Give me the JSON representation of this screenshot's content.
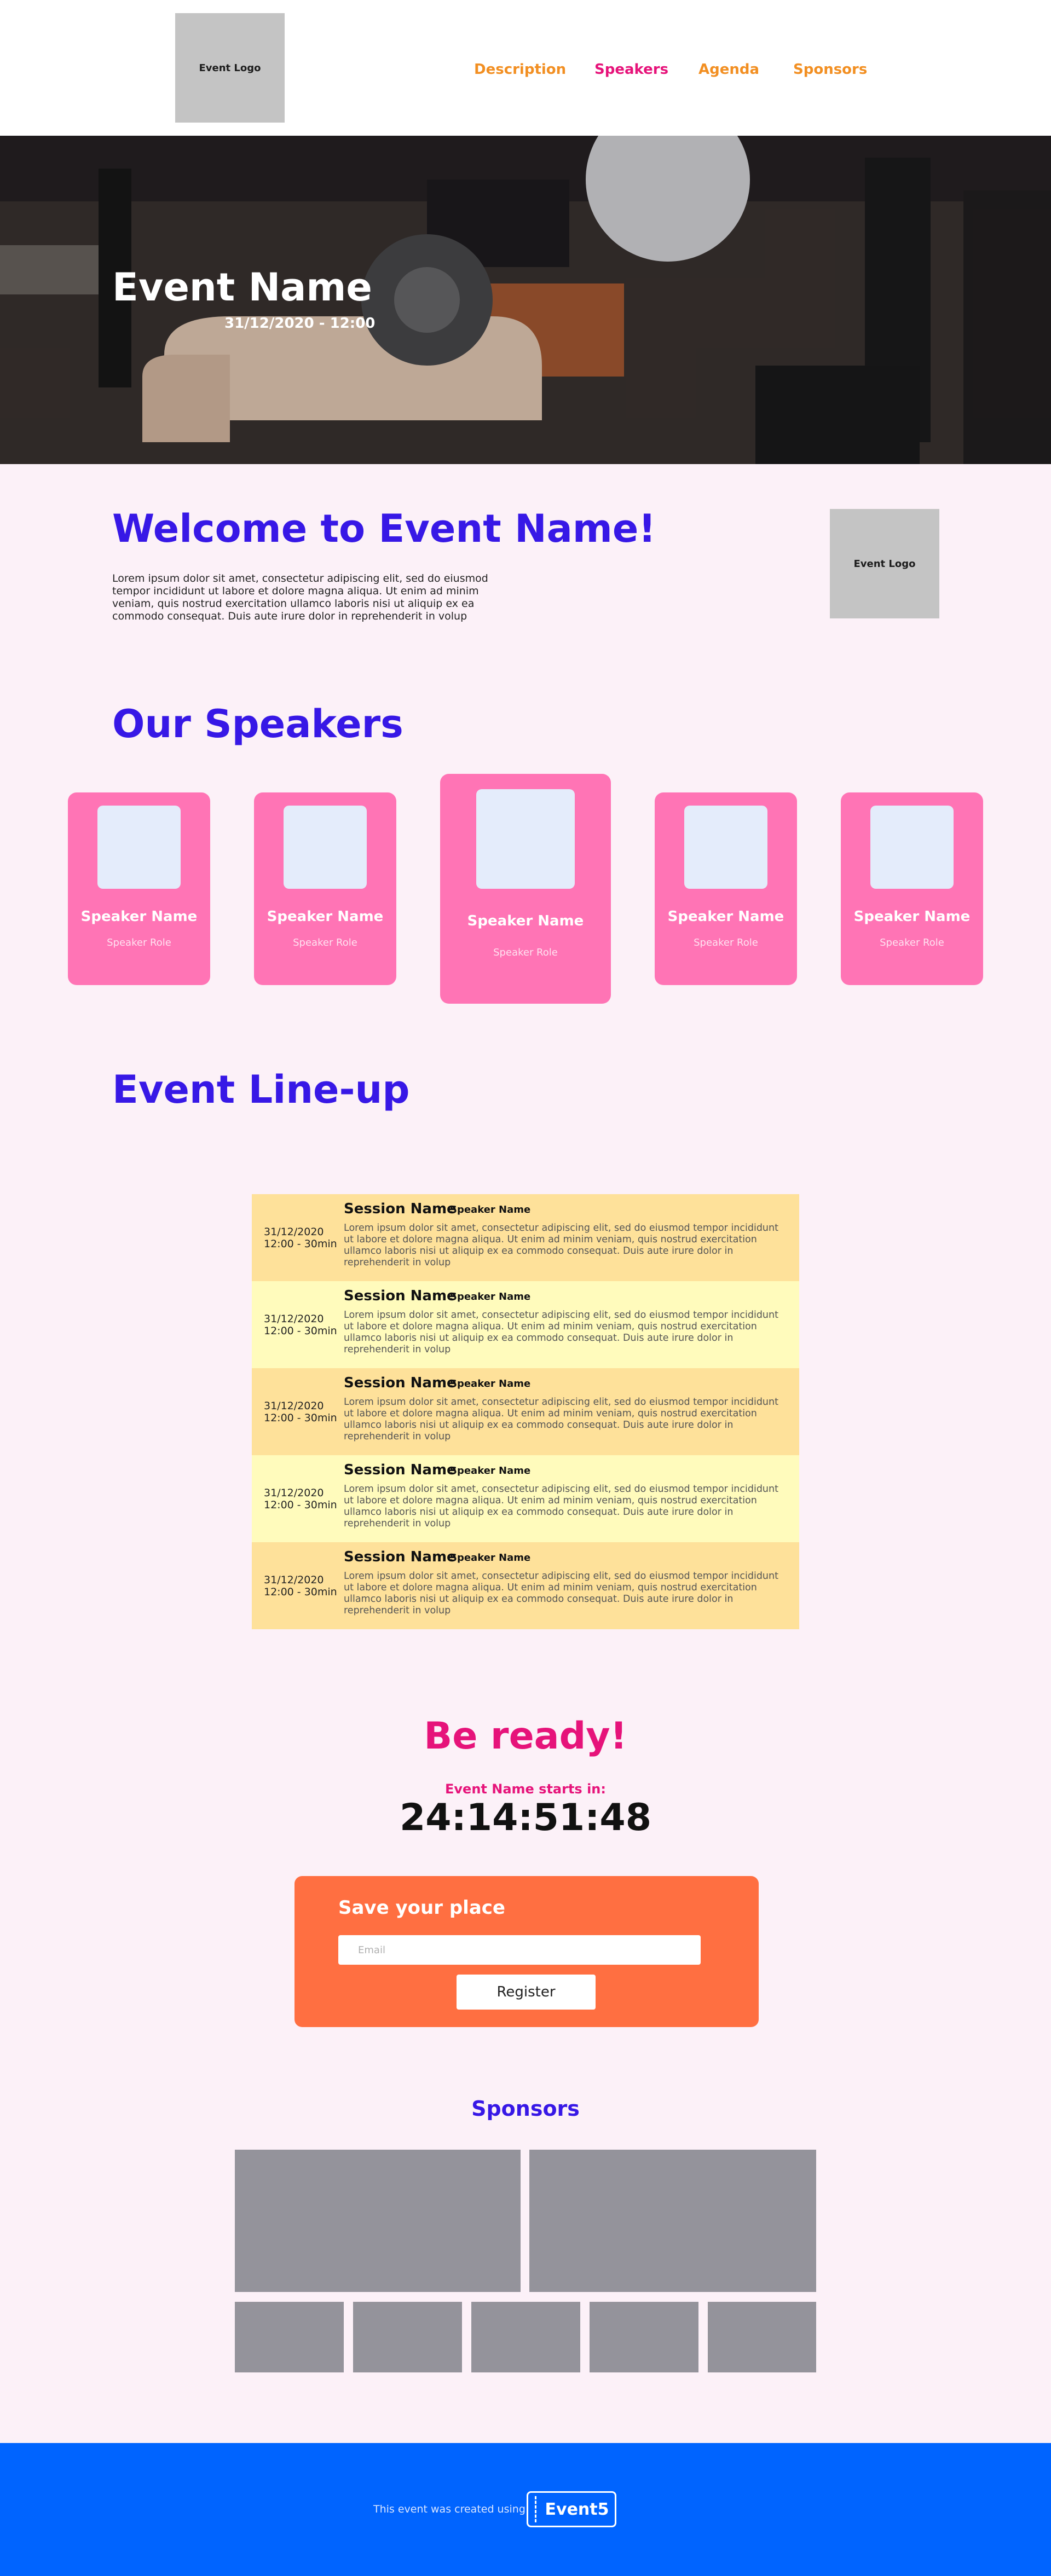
{
  "header": {
    "logo_label": "Event Logo",
    "nav": [
      {
        "label": "Description",
        "active": false
      },
      {
        "label": "Speakers",
        "active": true
      },
      {
        "label": "Agenda",
        "active": false
      },
      {
        "label": "Sponsors",
        "active": false
      }
    ]
  },
  "hero": {
    "title": "Event Name",
    "date": "31/12/2020 - 12:00"
  },
  "welcome": {
    "title": "Welcome to Event Name!",
    "text": "Lorem ipsum dolor sit amet, consectetur adipiscing elit, sed do eiusmod tempor incididunt ut labore et dolore magna aliqua. Ut enim ad minim veniam, quis nostrud exercitation ullamco laboris nisi ut aliquip ex ea commodo consequat. Duis aute irure dolor in reprehenderit in volup",
    "logo_label": "Event Logo"
  },
  "speakers": {
    "title": "Our Speakers",
    "items": [
      {
        "name": "Speaker Name",
        "role": "Speaker Role"
      },
      {
        "name": "Speaker Name",
        "role": "Speaker Role"
      },
      {
        "name": "Speaker Name",
        "role": "Speaker Role"
      },
      {
        "name": "Speaker Name",
        "role": "Speaker Role"
      },
      {
        "name": "Speaker Name",
        "role": "Speaker Role"
      }
    ]
  },
  "lineup": {
    "title": "Event Line-up",
    "sessions": [
      {
        "date": "31/12/2020",
        "time": "12:00 - 30min",
        "title": "Session Name",
        "speaker": "Speaker Name",
        "description": "Lorem ipsum dolor sit amet, consectetur adipiscing elit, sed do eiusmod tempor incididunt ut labore et dolore magna aliqua. Ut enim ad minim veniam, quis nostrud exercitation ullamco laboris nisi ut aliquip ex ea commodo consequat. Duis aute irure dolor in reprehenderit in volup"
      },
      {
        "date": "31/12/2020",
        "time": "12:00 - 30min",
        "title": "Session Name",
        "speaker": "Speaker Name",
        "description": "Lorem ipsum dolor sit amet, consectetur adipiscing elit, sed do eiusmod tempor incididunt ut labore et dolore magna aliqua. Ut enim ad minim veniam, quis nostrud exercitation ullamco laboris nisi ut aliquip ex ea commodo consequat. Duis aute irure dolor in reprehenderit in volup"
      },
      {
        "date": "31/12/2020",
        "time": "12:00 - 30min",
        "title": "Session Name",
        "speaker": "Speaker Name",
        "description": "Lorem ipsum dolor sit amet, consectetur adipiscing elit, sed do eiusmod tempor incididunt ut labore et dolore magna aliqua. Ut enim ad minim veniam, quis nostrud exercitation ullamco laboris nisi ut aliquip ex ea commodo consequat. Duis aute irure dolor in reprehenderit in volup"
      },
      {
        "date": "31/12/2020",
        "time": "12:00 - 30min",
        "title": "Session Name",
        "speaker": "Speaker Name",
        "description": "Lorem ipsum dolor sit amet, consectetur adipiscing elit, sed do eiusmod tempor incididunt ut labore et dolore magna aliqua. Ut enim ad minim veniam, quis nostrud exercitation ullamco laboris nisi ut aliquip ex ea commodo consequat. Duis aute irure dolor in reprehenderit in volup"
      },
      {
        "date": "31/12/2020",
        "time": "12:00 - 30min",
        "title": "Session Name",
        "speaker": "Speaker Name",
        "description": "Lorem ipsum dolor sit amet, consectetur adipiscing elit, sed do eiusmod tempor incididunt ut labore et dolore magna aliqua. Ut enim ad minim veniam, quis nostrud exercitation ullamco laboris nisi ut aliquip ex ea commodo consequat. Duis aute irure dolor in reprehenderit in volup"
      }
    ]
  },
  "countdown": {
    "title": "Be ready!",
    "subtitle": "Event Name starts in:",
    "value": "24:14:51:48"
  },
  "register": {
    "title": "Save your place",
    "email_placeholder": "Email",
    "button_label": "Register"
  },
  "sponsors": {
    "title": "Sponsors"
  },
  "footer": {
    "text": "This event was created using",
    "brand": "Event5"
  },
  "colors": {
    "accent_blue": "#3718e6",
    "accent_pink": "#e6137a",
    "nav_orange": "#f28f22",
    "card_pink": "#ff74b5",
    "register_orange": "#ff6f41",
    "footer_blue": "#0064ff"
  }
}
